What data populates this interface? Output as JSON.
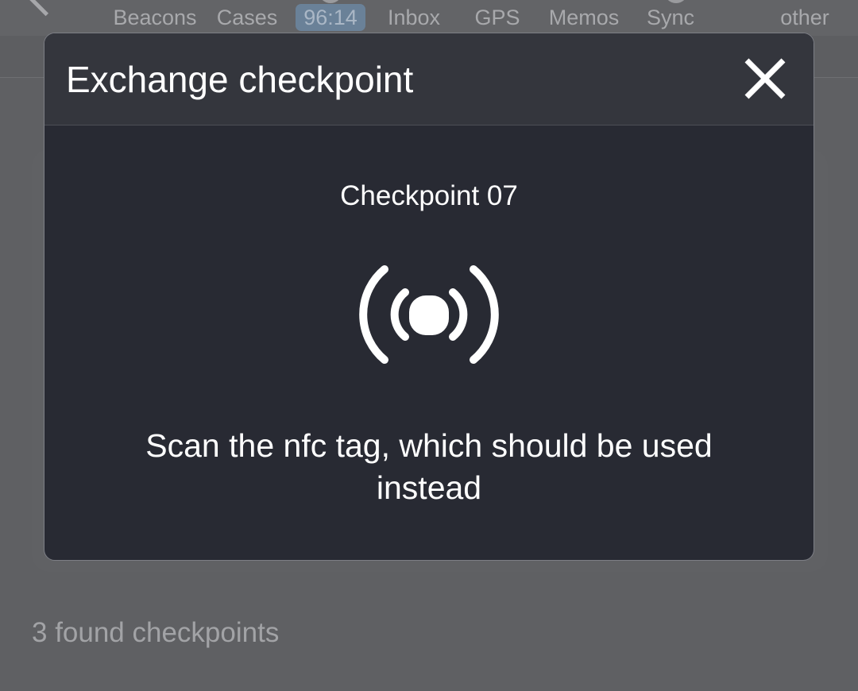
{
  "background": {
    "nav_tabs": [
      {
        "label": "Beacons"
      },
      {
        "label": "Cases"
      },
      {
        "label": "96:14"
      },
      {
        "label": "Inbox"
      },
      {
        "label": "GPS"
      },
      {
        "label": "Memos"
      },
      {
        "label": "Sync"
      },
      {
        "label": "other"
      }
    ],
    "found_count_text": "3 found checkpoints"
  },
  "dialog": {
    "title": "Exchange checkpoint",
    "checkpoint_name": "Checkpoint 07",
    "instruction": "Scan the nfc tag, which should be used instead",
    "icon": "nfc-scan-icon",
    "close_icon": "close-icon"
  },
  "colors": {
    "dialog_background": "#282a33",
    "dialog_header": "#34363d",
    "overlay_background": "#5f6063",
    "text_primary": "#ffffff",
    "badge_background": "#6a8198"
  }
}
